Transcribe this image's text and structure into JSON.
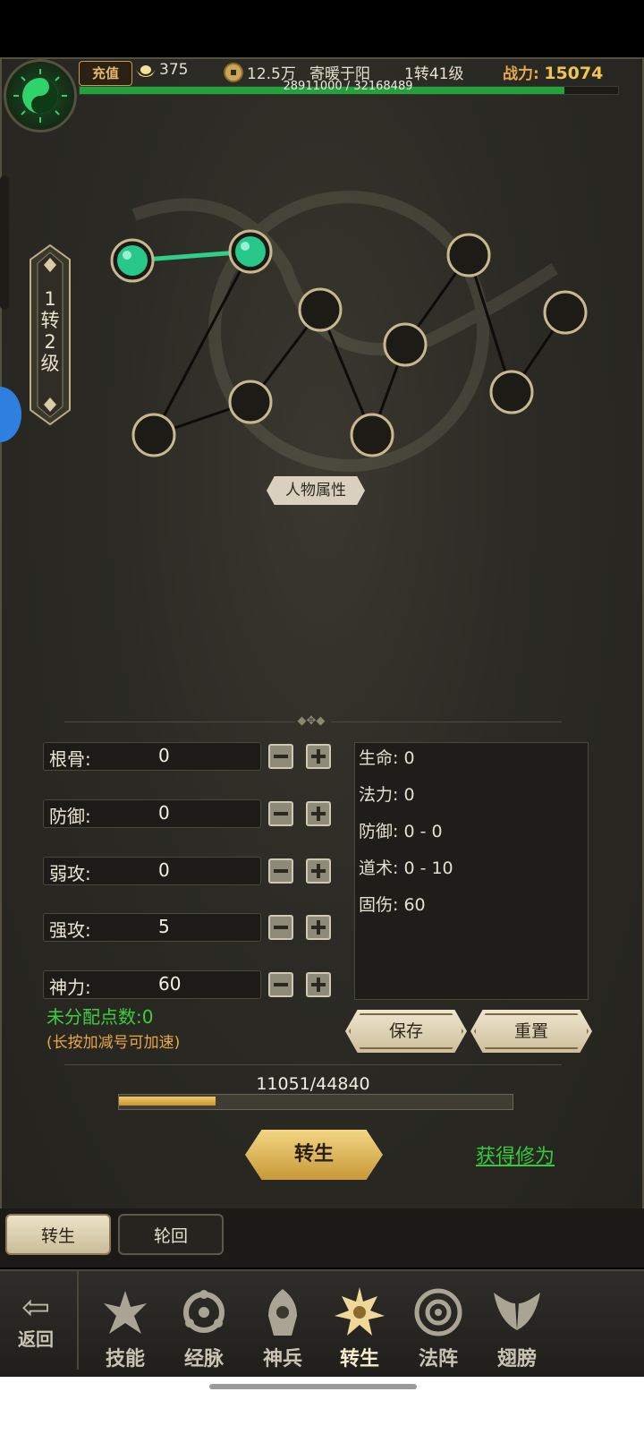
{
  "topbar": {
    "recharge": "充值",
    "yuanbao": "375",
    "coins": "12.5万",
    "player_name": "寄暖于阳",
    "level": "1转41级",
    "power_label": "战力:",
    "power_value": "15074",
    "exp_text": "28911000 / 32168489",
    "exp_fraction": 0.9
  },
  "rank": {
    "text": "1\n转\n2\n级"
  },
  "tree": {
    "nodes_active": 2,
    "label": "人物属性",
    "accent_active": "#2ecf8a"
  },
  "stats": [
    {
      "label": "根骨:",
      "value": "0"
    },
    {
      "label": "防御:",
      "value": "0"
    },
    {
      "label": "弱攻:",
      "value": "0"
    },
    {
      "label": "强攻:",
      "value": "5"
    },
    {
      "label": "神力:",
      "value": "60"
    }
  ],
  "attributes": [
    "生命: 0",
    "法力: 0",
    "防御: 0 - 0",
    "道术: 0 - 10",
    "固伤: 60"
  ],
  "unassigned": "未分配点数:0",
  "hint": "(长按加减号可加速)",
  "buttons": {
    "save": "保存",
    "reset": "重置",
    "rebirth": "转生",
    "get_xiuwei": "获得修为"
  },
  "progress": {
    "text": "11051/44840",
    "fraction": 0.246
  },
  "tabs": [
    {
      "label": "转生",
      "active": true
    },
    {
      "label": "轮回",
      "active": false
    }
  ],
  "nav": {
    "back": "返回",
    "items": [
      {
        "label": "技能",
        "icon": "skill-icon"
      },
      {
        "label": "经脉",
        "icon": "meridian-icon"
      },
      {
        "label": "神兵",
        "icon": "weapon-icon"
      },
      {
        "label": "转生",
        "icon": "rebirth-icon",
        "active": true
      },
      {
        "label": "法阵",
        "icon": "array-icon"
      },
      {
        "label": "翅膀",
        "icon": "wings-icon"
      }
    ]
  }
}
